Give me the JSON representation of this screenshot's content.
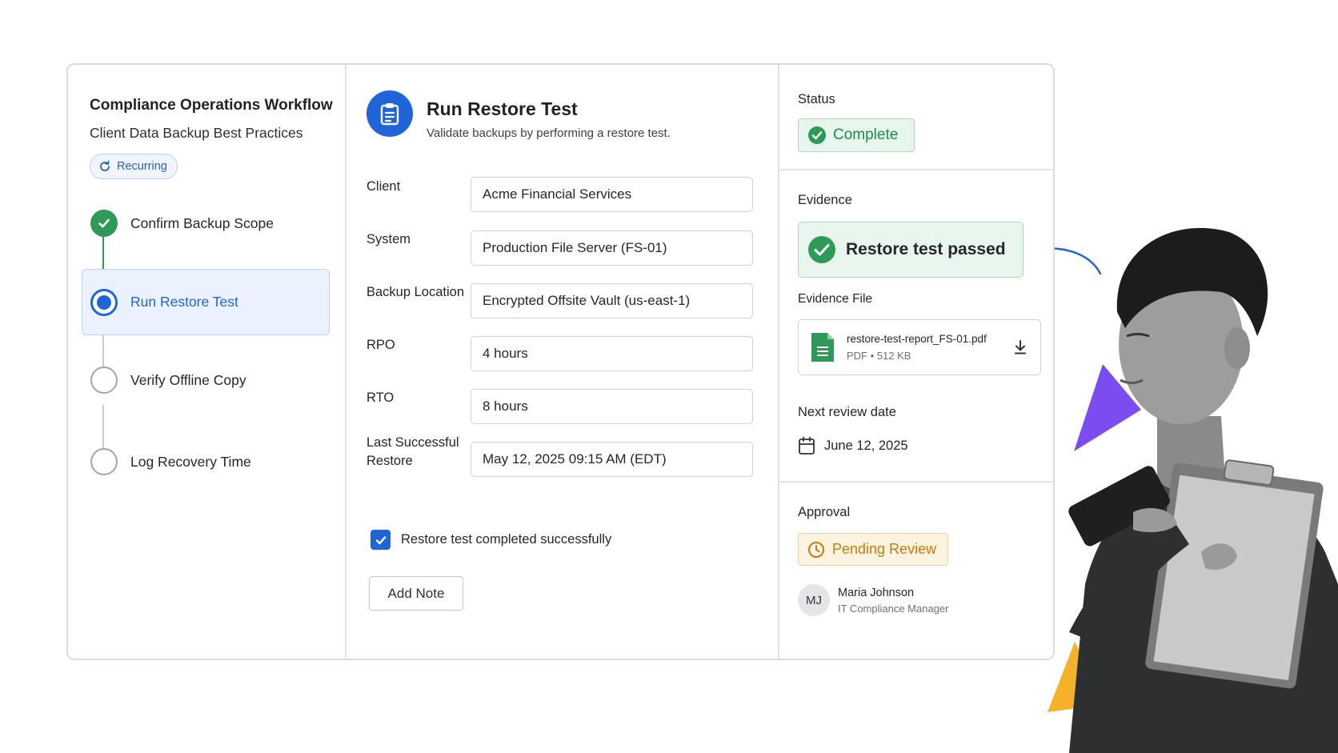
{
  "workflow": {
    "title": "Compliance Operations Workflow",
    "subtitle": "Client Data Backup Best Practices",
    "recurring_label": "Recurring",
    "steps": [
      {
        "label": "Confirm Backup Scope",
        "state": "done"
      },
      {
        "label": "Run Restore Test",
        "state": "current"
      },
      {
        "label": "Verify Offline Copy",
        "state": "todo"
      },
      {
        "label": "Log Recovery Time",
        "state": "todo"
      }
    ]
  },
  "task": {
    "title": "Run Restore Test",
    "description": "Validate backups by performing a restore test.",
    "icon": "clipboard-icon",
    "fields": [
      {
        "label": "Client",
        "value": "Acme Financial Services"
      },
      {
        "label": "System",
        "value": "Production File Server (FS-01)"
      },
      {
        "label": "Backup Location",
        "value": "Encrypted Offsite Vault (us-east-1)"
      },
      {
        "label": "RPO",
        "value": "4 hours"
      },
      {
        "label": "RTO",
        "value": "8 hours"
      },
      {
        "label": "Last Successful Restore",
        "value": "May 12, 2025 09:15 AM (EDT)"
      }
    ],
    "checkbox_label": "Restore test completed successfully",
    "checkbox_checked": true,
    "add_note_label": "Add Note"
  },
  "status": {
    "title": "Status",
    "value": "Complete"
  },
  "evidence": {
    "title": "Evidence",
    "result": "Restore test passed",
    "file_title": "Evidence File",
    "file_name": "restore-test-report_FS-01.pdf",
    "file_meta": "PDF • 512 KB"
  },
  "review": {
    "title": "Next review date",
    "date": "June 12, 2025"
  },
  "approval": {
    "title": "Approval",
    "status": "Pending Review",
    "approver_initials": "MJ",
    "approver_name": "Maria Johnson",
    "approver_role": "IT Compliance Manager"
  },
  "colors": {
    "accent": "#1f64d8",
    "success": "#2f9a58",
    "warning": "#c47a10",
    "decor_purple": "#7b4cf0",
    "decor_yellow": "#f4b12b"
  }
}
